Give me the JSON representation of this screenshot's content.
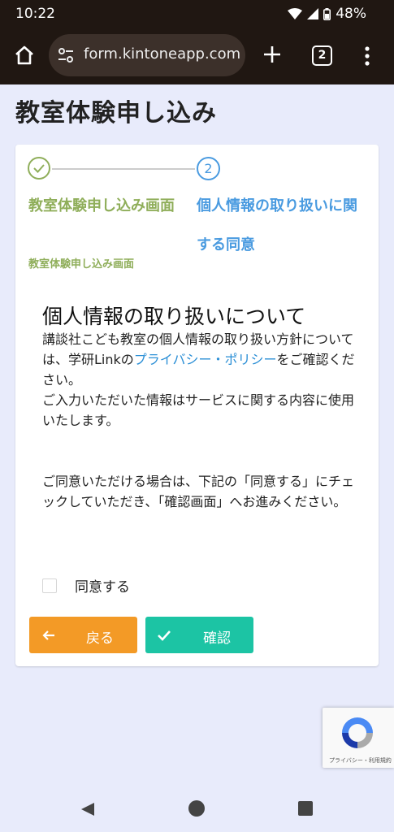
{
  "status": {
    "time": "10:22",
    "battery": "48%"
  },
  "browser": {
    "url": "form.kintoneapp.com",
    "tab_count": "2"
  },
  "page": {
    "title": "教室体験申し込み"
  },
  "steps": {
    "step1_label": "教室体験申し込み画面",
    "step1_sub": "教室体験申し込み画面",
    "step2_number": "2",
    "step2_label": "個人情報の取り扱いに関する同意"
  },
  "section": {
    "heading": "個人情報の取り扱いについて",
    "p1_before": "講談社こども教室の個人情報の取り扱い方針については、学研Linkの",
    "p1_link": "プライバシー・ポリシー",
    "p1_after": "をご確認ください。",
    "p2": "ご入力いただいた情報はサービスに関する内容に使用いたします。",
    "p3": "ご同意いただける場合は、下記の「同意する」にチェックしていただき、「確認画面」へお進みください。"
  },
  "consent": {
    "label": "同意する",
    "checked": false
  },
  "buttons": {
    "back_label": "戻る",
    "confirm_label": "確認"
  },
  "colors": {
    "step_done": "#8fae5a",
    "step_active": "#4a9be0",
    "back": "#f39a26",
    "confirm": "#1cc4a4",
    "link": "#2b8fd6"
  },
  "recaptcha": {
    "terms": "プライバシー・利用規約"
  }
}
